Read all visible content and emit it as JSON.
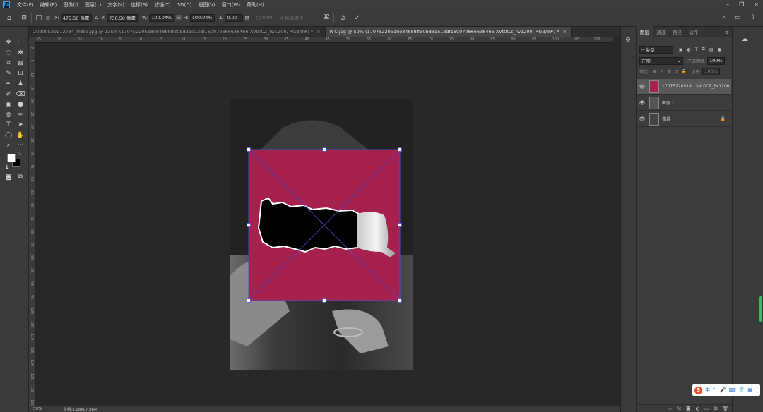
{
  "menu": {
    "items": [
      "文件(F)",
      "编辑(E)",
      "图像(I)",
      "图层(L)",
      "文字(Y)",
      "选择(S)",
      "滤镜(T)",
      "3D(D)",
      "视图(V)",
      "窗口(W)",
      "帮助(H)"
    ]
  },
  "options": {
    "x_label": "X:",
    "x_value": "475.50 像素",
    "y_label": "Y:",
    "y_value": "730.50 像素",
    "w_label": "W:",
    "w_value": "100.04%",
    "h_label": "H:",
    "h_value": "100.04%",
    "angle_value": "0.00",
    "angle_unit": "度",
    "interp_label": "插值模式"
  },
  "tabs": [
    {
      "label": "20200529212734_rfdqd.jpg @ 135% (17075220518e84888ff30bd31e13df160070666636466-XVt0CZ_fw1200, RGB/8#) *",
      "close": "×",
      "active": false
    },
    {
      "label": "R-C.jpg @ 50% (17075220518e84888ff30bd31e13df160070666636466-XVt0CZ_fw1200, RGB/8#) *",
      "close": "×",
      "active": true
    }
  ],
  "ruler": {
    "top": [
      "25",
      "20",
      "15",
      "10",
      "5",
      "0",
      "5",
      "10",
      "15",
      "20",
      "25",
      "30",
      "35",
      "40",
      "45",
      "50",
      "55",
      "60",
      "65",
      "70",
      "75",
      "80",
      "85",
      "90",
      "95",
      "100",
      "105",
      "110"
    ],
    "left": [
      "0",
      "5",
      "10",
      "15",
      "20",
      "25",
      "30",
      "35",
      "40",
      "45",
      "50",
      "55",
      "60",
      "65",
      "70",
      "75",
      "80",
      "85",
      "90",
      "95",
      "100",
      "105",
      "110",
      "115",
      "120",
      "125",
      "130",
      "135"
    ]
  },
  "status": {
    "zoom": "50%",
    "doc": "文档:3.98M/7.96M"
  },
  "panel": {
    "tabs": [
      "图层",
      "通道",
      "路径",
      "动作"
    ],
    "filter_label": "类型",
    "blend_mode": "正常",
    "opacity_label": "不透明度:",
    "opacity_value": "100%",
    "lock_label": "锁定:",
    "fill_label": "填充:",
    "fill_value": "100%",
    "layers": [
      {
        "name": "17075220518...XVt0CZ_fw1200",
        "selected": true
      },
      {
        "name": "图层 1",
        "selected": false
      },
      {
        "name": "背景",
        "selected": false,
        "locked": true
      }
    ]
  },
  "ime": {
    "text": "中"
  },
  "colors": {
    "magenta": "#a7214f",
    "handle_line": "#4b4bd1"
  }
}
